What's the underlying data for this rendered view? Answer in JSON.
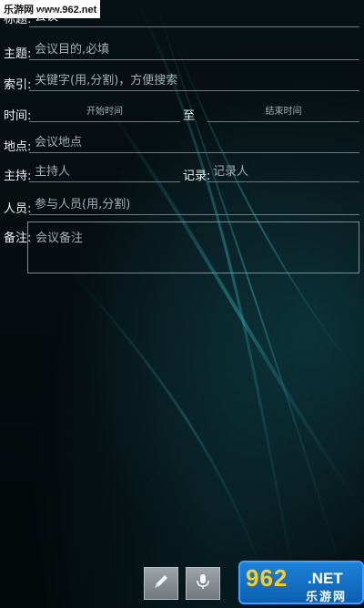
{
  "watermark": {
    "top_text": "乐游网 www.962.net",
    "logo_number": "962",
    "logo_suffix": ".NET",
    "logo_cn": "乐游网"
  },
  "form": {
    "title_label": "标题:",
    "title_value": "会议",
    "subject_label": "主题:",
    "subject_placeholder": "会议目的,必填",
    "index_label": "索引:",
    "index_placeholder": "关键字(用,分割)，方便搜索",
    "time_label": "时间:",
    "start_placeholder": "开始时间",
    "to_label": "至",
    "end_placeholder": "结束时间",
    "place_label": "地点:",
    "place_placeholder": "会议地点",
    "host_label": "主持:",
    "host_placeholder": "主持人",
    "recorder_label": "记录:",
    "recorder_placeholder": "记录人",
    "people_label": "人员:",
    "people_placeholder": "参与人员(用,分割)",
    "memo_label": "备注:",
    "memo_placeholder": "会议备注"
  },
  "toolbar": {
    "edit_icon": "pencil-icon",
    "voice_icon": "microphone-icon"
  },
  "colors": {
    "background": "#050b0e",
    "underline": "#6b7b80",
    "hint": "#9fb0b6",
    "logo_blue": "#1c82d8",
    "logo_yellow": "#ffcc1a"
  }
}
